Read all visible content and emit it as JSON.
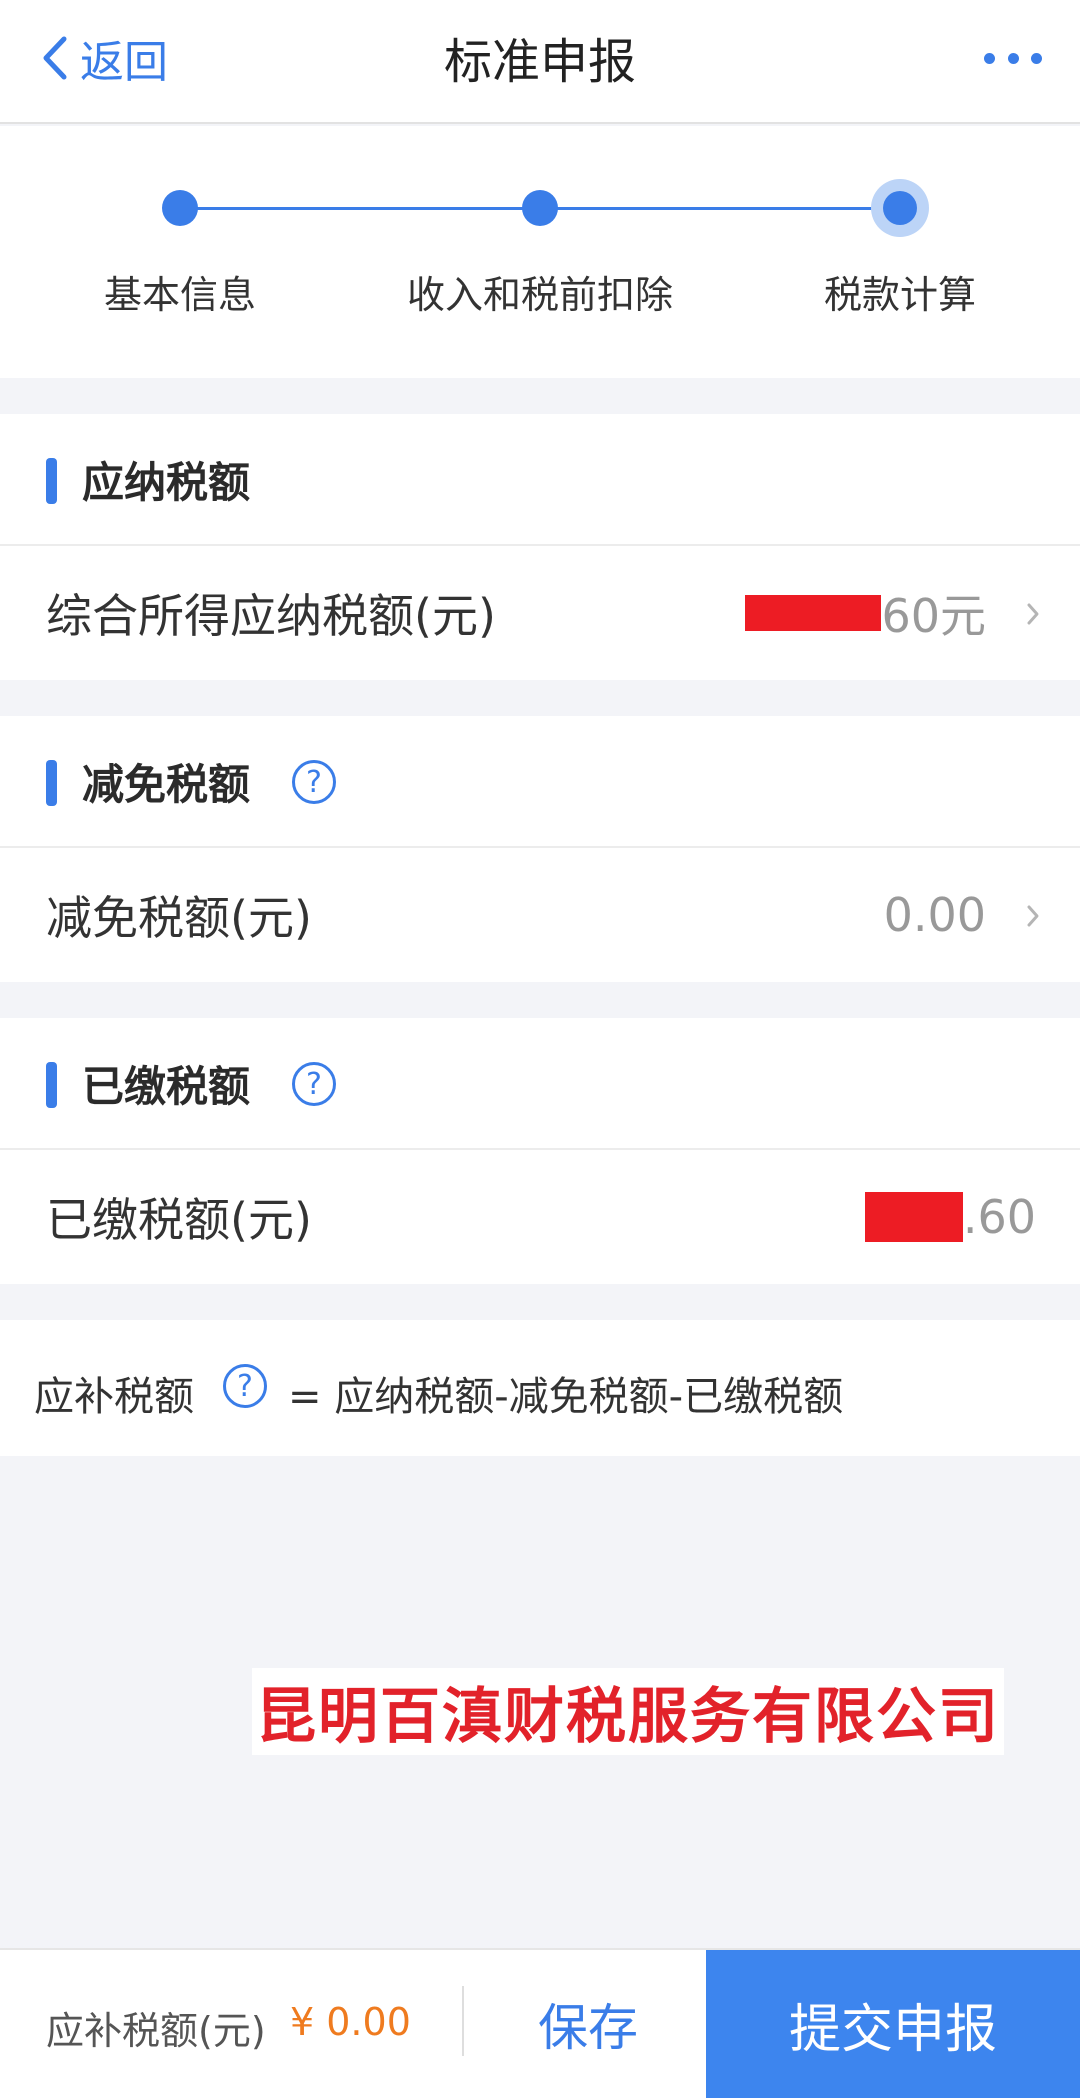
{
  "header": {
    "back_label": "返回",
    "title": "标准申报"
  },
  "stepper": {
    "steps": [
      {
        "label": "基本信息",
        "state": "done"
      },
      {
        "label": "收入和税前扣除",
        "state": "done"
      },
      {
        "label": "税款计算",
        "state": "current"
      }
    ]
  },
  "sections": [
    {
      "title": "应纳税额",
      "has_help": false,
      "row_label": "综合所得应纳税额(元)",
      "row_value_visible": "60元",
      "value_redacted": true
    },
    {
      "title": "减免税额",
      "has_help": true,
      "row_label": "减免税额(元)",
      "row_value_visible": "0.00",
      "value_redacted": false
    },
    {
      "title": "已缴税额",
      "has_help": true,
      "row_label": "已缴税额(元)",
      "row_value_visible": ".60",
      "value_redacted": true
    }
  ],
  "formula": {
    "label": "应补税额",
    "text": "= 应纳税额-减免税额-已缴税额"
  },
  "watermark": "昆明百滇财税服务有限公司",
  "bottom": {
    "due_label": "应补税额(元)",
    "due_amount": "¥ 0.00",
    "save_label": "保存",
    "submit_label": "提交申报"
  },
  "icons": {
    "back": "chevron-left-icon",
    "more": "more-dots-icon",
    "help": "question-circle-icon",
    "row_arrow": "chevron-right-icon"
  },
  "help_glyph": "?",
  "colors": {
    "primary": "#3a7de8",
    "amount": "#ef7b1f",
    "watermark": "#e2222a",
    "redaction": "#ed1c24"
  }
}
